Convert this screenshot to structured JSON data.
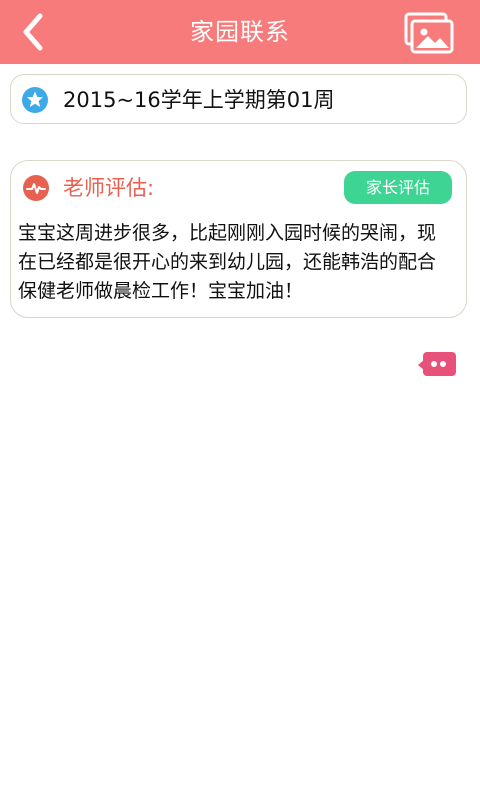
{
  "header": {
    "title": "家园联系",
    "back_icon": "chevron-left-icon",
    "gallery_icon": "image-gallery-icon",
    "background_color": "#f77b7b"
  },
  "week": {
    "text": "2015~16学年上学期第01周",
    "icon": "star-icon",
    "icon_color": "#3da9e6"
  },
  "evaluation": {
    "title": "老师评估:",
    "icon": "heartbeat-icon",
    "title_color": "#e8604f",
    "parent_button_label": "家长评估",
    "parent_button_color": "#3ed493",
    "body": "宝宝这周进步很多，比起刚刚入园时候的哭闹，现在已经都是很开心的来到幼儿园，还能韩浩的配合保健老师做晨检工作！宝宝加油！"
  },
  "chat": {
    "icon": "chat-bubble-icon",
    "color": "#e8527a"
  }
}
